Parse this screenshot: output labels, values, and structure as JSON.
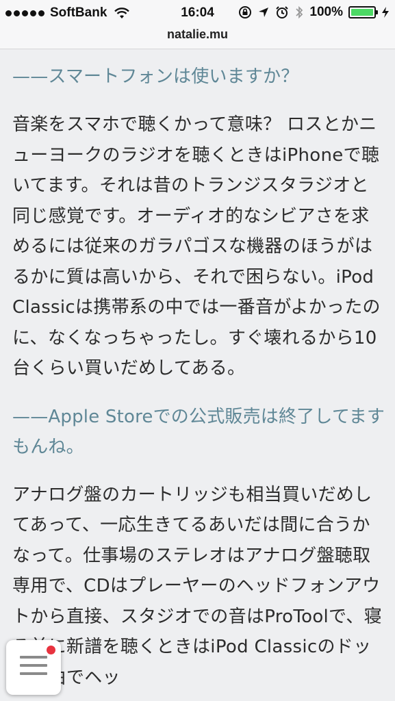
{
  "status_bar": {
    "carrier": "SoftBank",
    "time": "16:04",
    "battery": "100%",
    "battery_level": 1.0,
    "battery_color": "#4cd964"
  },
  "address_bar": {
    "url": "natalie.mu"
  },
  "article": {
    "blocks": [
      {
        "type": "question",
        "text": "——スマートフォンは使いますか？"
      },
      {
        "type": "answer",
        "text": "音楽をスマホで聴くかって意味？ ロスとかニューヨークのラジオを聴くときはiPhoneで聴いてます。それは昔のトランジスタラジオと同じ感覚です。オーディオ的なシビアさを求めるには従来のガラパゴスな機器のほうがはるかに質は高いから、それで困らない。iPod Classicは携帯系の中では一番音がよかったのに、なくなっちゃったし。すぐ壊れるから10台くらい買いだめしてある。"
      },
      {
        "type": "question",
        "text": "——Apple Storeでの公式販売は終了してますもんね。"
      },
      {
        "type": "answer",
        "text": "アナログ盤のカートリッジも相当買いだめしてあって、一応生きてるあいだは間に合うかなって。仕事場のステレオはアナログ盤聴取専用で、CDはプレーヤーのヘッドフォンアウトから直接、スタジオでの音はProToolで、寝る前に新譜を聴くときはiPod Classicのドック経由でヘッ"
      }
    ]
  },
  "menu_button": {
    "icon": "hamburger-icon",
    "badge_color": "#e8333f"
  },
  "colors": {
    "question": "#5f8796",
    "answer": "#2c2c2c",
    "background": "#eeeff1"
  }
}
